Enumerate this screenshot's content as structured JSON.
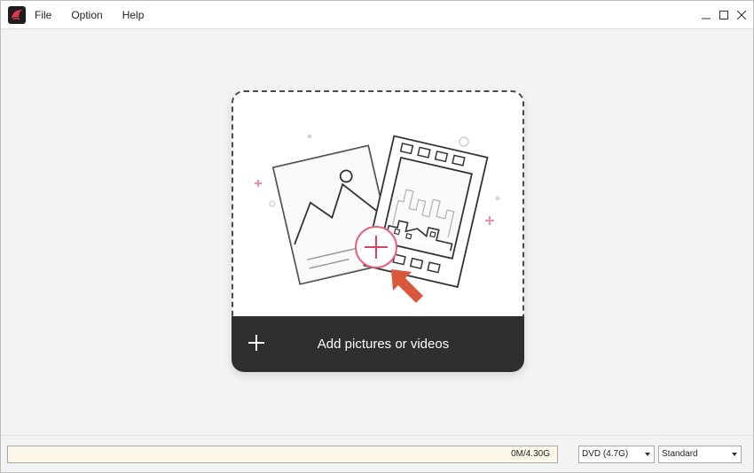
{
  "menu": {
    "items": [
      {
        "label": "File"
      },
      {
        "label": "Option"
      },
      {
        "label": "Help"
      }
    ]
  },
  "window_controls": {
    "icons": [
      "minimize-icon",
      "maximize-icon",
      "close-icon"
    ]
  },
  "drop_area": {
    "add_label": "Add pictures or videos",
    "accent_color": "#e8637a",
    "arrow_color": "#d9573a",
    "bar_color": "#2f2f2f"
  },
  "status": {
    "capacity_text": "0M/4.30G",
    "capacity_used_fraction": 0,
    "disc_type": "DVD (4.7G)",
    "quality": "Standard"
  }
}
